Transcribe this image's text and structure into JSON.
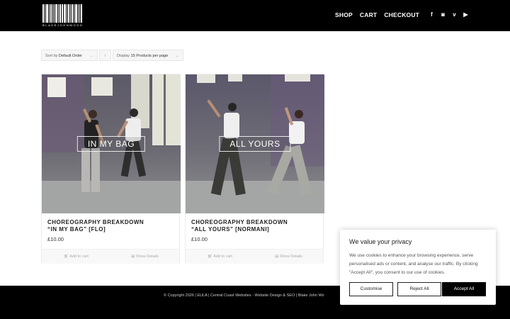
{
  "brand": {
    "logo_text": "BLAKEJOHNWOOD"
  },
  "nav": {
    "items": [
      "SHOP",
      "CART",
      "CHECKOUT"
    ]
  },
  "social": {
    "icons": [
      {
        "name": "facebook-icon",
        "glyph": "f"
      },
      {
        "name": "instagram-icon",
        "glyph": "◙"
      },
      {
        "name": "vimeo-icon",
        "glyph": "v"
      },
      {
        "name": "youtube-icon",
        "glyph": "▶"
      }
    ]
  },
  "sort": {
    "sort_prefix": "Sort by",
    "sort_value": "Default Order",
    "direction_symbol": "↑",
    "display_prefix": "Display",
    "display_value": "15 Products per page"
  },
  "products": [
    {
      "image_caption": "IN MY BAG",
      "title_line1": "CHOREOGRAPHY BREAKDOWN",
      "title_line2": "“IN MY BAG” [FLO]",
      "price": "£10.00",
      "add_to_cart": "Add to cart",
      "show_details": "Show Details"
    },
    {
      "image_caption": "ALL YOURS",
      "title_line1": "CHOREOGRAPHY BREAKDOWN",
      "title_line2": "“ALL YOURS” [NORMANI]",
      "price": "£10.00",
      "add_to_cart": "Add to cart",
      "show_details": "Show Details"
    }
  ],
  "footer": {
    "text": "© Copyright 2026 | EULA | Central Coast Websites - Website Design & SEO | Blake John Wo"
  },
  "cookie": {
    "title": "We value your privacy",
    "body": "We use cookies to enhance your browsing experience, serve personalised ads or content, and analyse our traffic. By clicking \"Accept All\", you consent to our use of cookies.",
    "customise": "Customise",
    "reject": "Reject All",
    "accept": "Accept All"
  },
  "colors": {
    "header_bg": "#000000",
    "footer_bg": "#000000",
    "accent": "#000000"
  }
}
